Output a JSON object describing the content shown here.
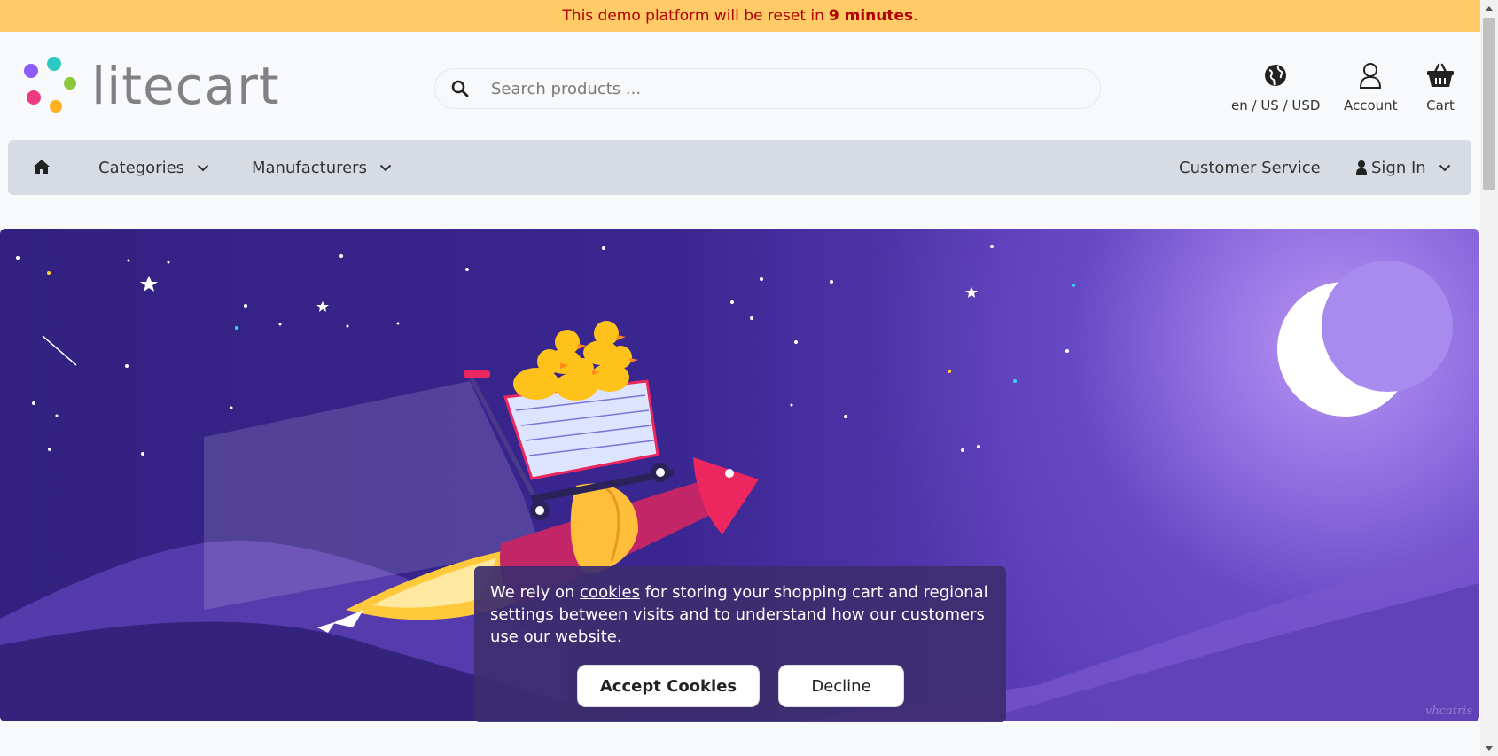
{
  "notice": {
    "prefix": "This demo platform will be reset in",
    "highlight": "9 minutes",
    "suffix": "."
  },
  "logo": {
    "text": "litecart"
  },
  "search": {
    "placeholder": "Search products ..."
  },
  "header": {
    "region_label": "en / US / USD",
    "account_label": "Account",
    "cart_label": "Cart"
  },
  "nav": {
    "categories_label": "Categories",
    "manufacturers_label": "Manufacturers",
    "customer_service_label": "Customer Service",
    "sign_in_label": "Sign In"
  },
  "hero": {
    "watermark": "vhcatris"
  },
  "cookie": {
    "text_before": "We rely on",
    "link_label": "cookies",
    "text_after": "for storing your shopping cart and regional settings between visits and to understand how our customers use our website.",
    "accept_label": "Accept Cookies",
    "decline_label": "Decline"
  },
  "colors": {
    "notice_bg": "#ffcb66",
    "notice_text": "#b00000",
    "nav_bg": "#d7dbe3",
    "hero_bg": "#3a2690"
  },
  "icons": [
    "search-icon",
    "globe-icon",
    "user-icon",
    "basket-icon",
    "home-icon",
    "chevron-down-icon",
    "lock-user-icon",
    "moon-icon"
  ]
}
